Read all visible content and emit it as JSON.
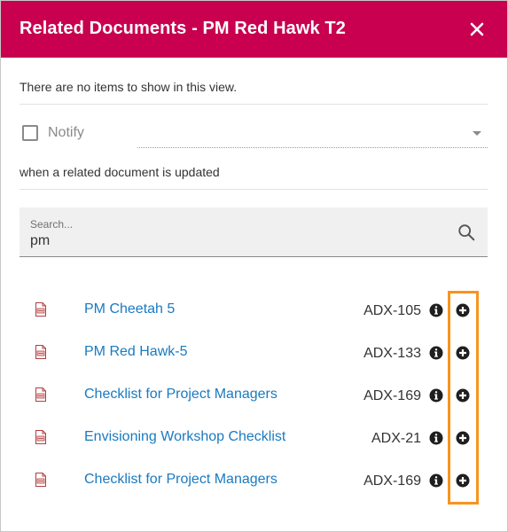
{
  "dialog": {
    "title": "Related Documents - PM Red Hawk T2",
    "close_icon": "close-icon"
  },
  "empty_message": "There are no items to show in this view.",
  "notify": {
    "label": "Notify",
    "checked": false,
    "selected_value": "",
    "updated_text": "when a related document is updated"
  },
  "search": {
    "label": "Search...",
    "value": "pm",
    "icon": "search-icon"
  },
  "documents": [
    {
      "title": "PM Cheetah 5",
      "id": "ADX-105",
      "file_icon": "document-icon",
      "info_icon": "info-icon",
      "add_icon": "add-circle-icon"
    },
    {
      "title": "PM Red Hawk-5",
      "id": "ADX-133",
      "file_icon": "document-icon",
      "info_icon": "info-icon",
      "add_icon": "add-circle-icon"
    },
    {
      "title": "Checklist for Project Managers",
      "id": "ADX-169",
      "file_icon": "document-icon",
      "info_icon": "info-icon",
      "add_icon": "add-circle-icon"
    },
    {
      "title": "Envisioning Workshop Checklist",
      "id": "ADX-21",
      "file_icon": "document-icon",
      "info_icon": "info-icon",
      "add_icon": "add-circle-icon"
    },
    {
      "title": "Checklist for Project Managers",
      "id": "ADX-169",
      "file_icon": "document-icon",
      "info_icon": "info-icon",
      "add_icon": "add-circle-icon"
    }
  ],
  "colors": {
    "header_bg": "#c8004f",
    "link": "#1a7ac0",
    "highlight": "#f7941d"
  }
}
